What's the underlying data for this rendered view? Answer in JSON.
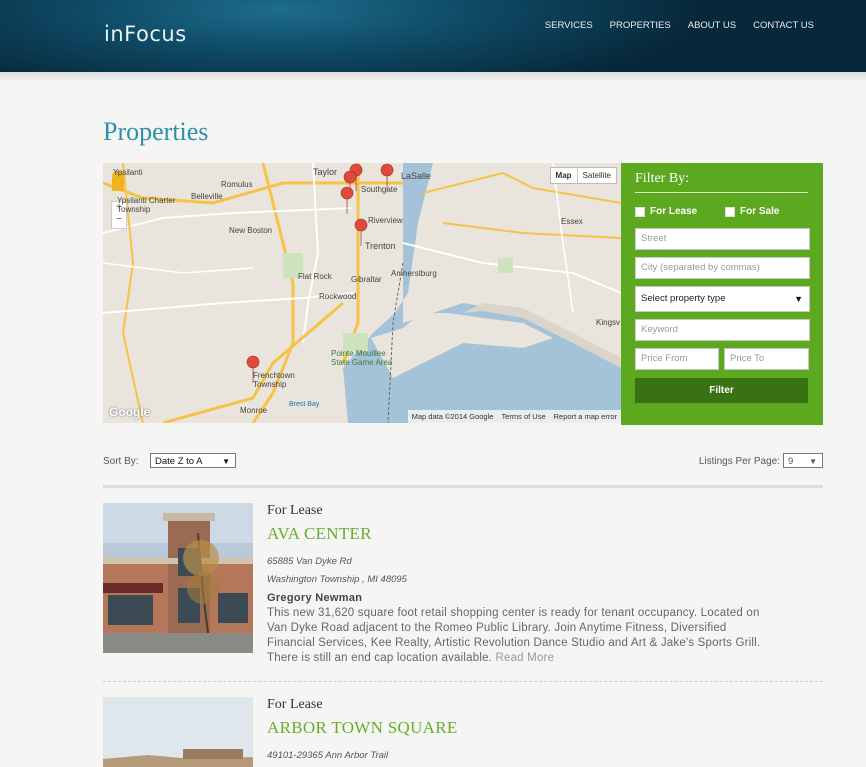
{
  "brand": {
    "logo_in": "in",
    "logo_focus": "Focus"
  },
  "nav": [
    "SERVICES",
    "PROPERTIES",
    "ABOUT US",
    "CONTACT US"
  ],
  "page_title": "Properties",
  "map": {
    "type_buttons": [
      "Map",
      "Satellite"
    ],
    "footer": [
      "Map data ©2014 Google",
      "Terms of Use",
      "Report a map error"
    ],
    "google_label": "Google",
    "places": [
      "Ypsilanti",
      "Ypsilanti Charter Township",
      "Belleville",
      "Romulus",
      "Taylor",
      "Southgate",
      "LaSalle",
      "New Boston",
      "Riverview",
      "Trenton",
      "Essex",
      "Flat Rock",
      "Gibraltar",
      "Amherstburg",
      "Rockwood",
      "Kingsv",
      "Pointe Mouillee State Game Area",
      "Frenchtown Township",
      "Brest Bay",
      "Monroe"
    ],
    "zoom": [
      "+",
      "−"
    ]
  },
  "filter": {
    "title": "Filter By:",
    "for_lease": "For Lease",
    "for_sale": "For Sale",
    "street_placeholder": "Street",
    "city_placeholder": "City (separated by commas)",
    "property_type": "Select property type",
    "keyword_placeholder": "Keyword",
    "price_from_placeholder": "Price From",
    "price_to_placeholder": "Price To",
    "button": "Filter"
  },
  "sort": {
    "label": "Sort By:",
    "value": "Date Z to A"
  },
  "per_page": {
    "label": "Listings Per Page:",
    "value": "9"
  },
  "listings": [
    {
      "type": "For Lease",
      "name": "AVA CENTER",
      "address1": "65885 Van Dyke Rd",
      "address2": "Washington Township , MI 48095",
      "agent": "Gregory Newman",
      "description": "This new 31,620 square foot retail shopping center is ready for tenant occupancy. Located on Van Dyke Road adjacent to the Romeo Public Library. Join Anytime Fitness, Diversified Financial Services, Kee Realty, Artistic Revolution Dance Studio and Art & Jake's Sports Grill. There is still an end cap location available.",
      "read_more": "Read More"
    },
    {
      "type": "For Lease",
      "name": "ARBOR TOWN SQUARE",
      "address1": "49101-29365 Ann Arbor Trail"
    }
  ]
}
